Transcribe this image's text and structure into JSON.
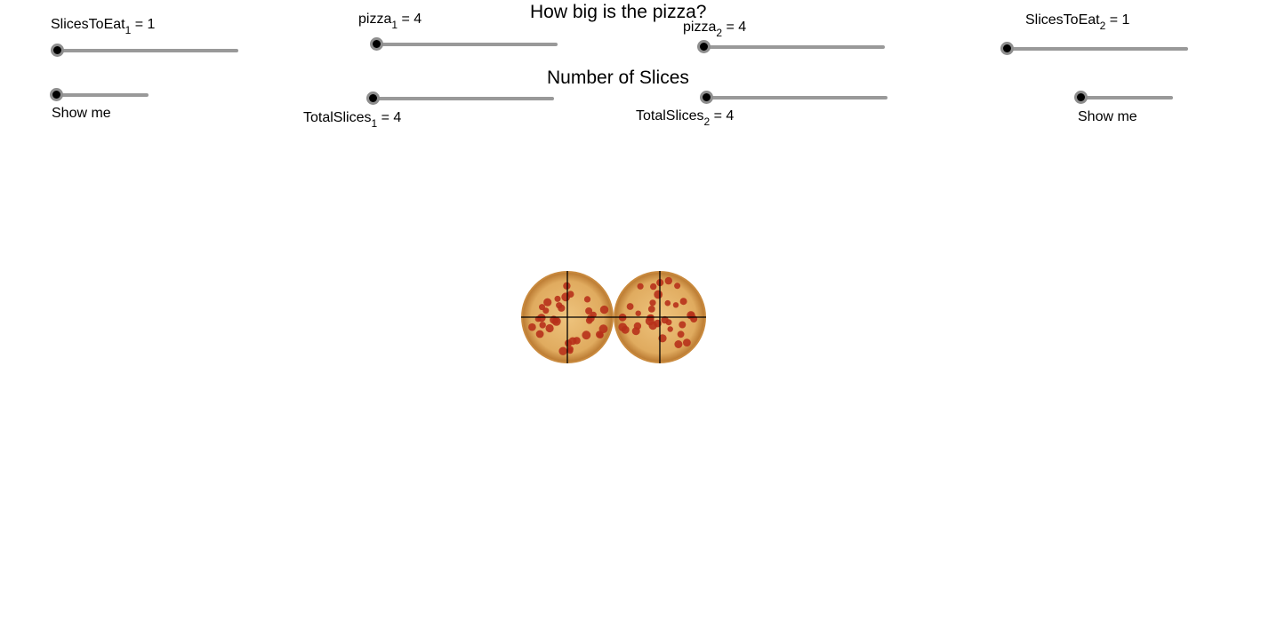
{
  "headings": {
    "title": "How big is the pizza?",
    "subtitle": "Number of Slices"
  },
  "sliders": [
    {
      "id": "slices_to_eat_1",
      "name": "SlicesToEat",
      "sub": "1",
      "eq": " = 1",
      "value": 1,
      "fraction": 0.0
    },
    {
      "id": "pizza_1",
      "name": "pizza",
      "sub": "1",
      "eq": " = 4",
      "value": 4,
      "fraction": 0.0
    },
    {
      "id": "pizza_2",
      "name": "pizza",
      "sub": "2",
      "eq": " = 4",
      "value": 4,
      "fraction": 0.0
    },
    {
      "id": "slices_to_eat_2",
      "name": "SlicesToEat",
      "sub": "2",
      "eq": " = 1",
      "value": 1,
      "fraction": 0.0
    },
    {
      "id": "show_me_1",
      "label": "Show me",
      "fraction": 0.0
    },
    {
      "id": "total_slices_1",
      "name": "TotalSlices",
      "sub": "1",
      "eq": " = 4",
      "value": 4,
      "fraction": 0.0
    },
    {
      "id": "total_slices_2",
      "name": "TotalSlices",
      "sub": "2",
      "eq": " = 4",
      "value": 4,
      "fraction": 0.0
    },
    {
      "id": "show_me_2",
      "label": "Show me",
      "fraction": 0.0
    }
  ],
  "pizzas": [
    {
      "id": "pizza_left",
      "slices": 4
    },
    {
      "id": "pizza_right",
      "slices": 4
    }
  ],
  "colors": {
    "crust": "#c98a3e",
    "cheese": "#e4b46a",
    "pepperoni": "#b7311b",
    "cut_line": "#000000",
    "track": "#999999",
    "thumb": "#000000",
    "thumb_ring": "#8e8e8e"
  }
}
